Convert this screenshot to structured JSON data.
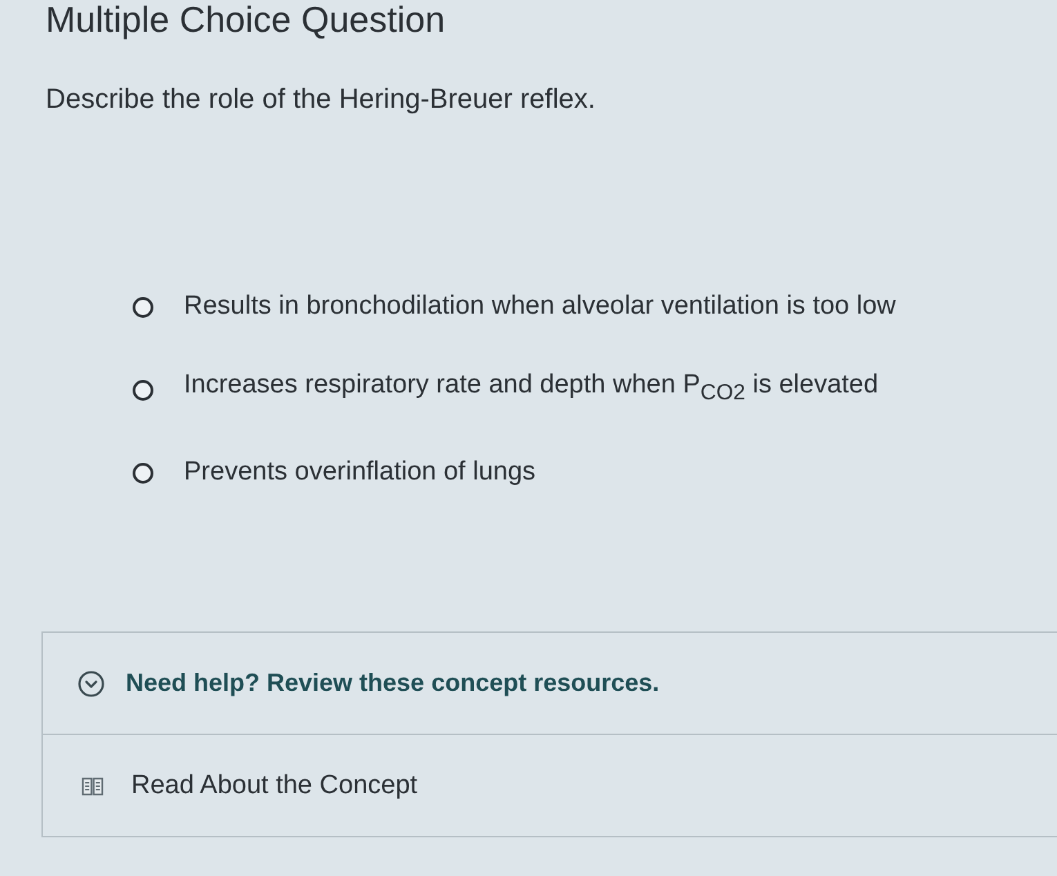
{
  "header": {
    "title": "Multiple Choice Question"
  },
  "question": {
    "prompt": "Describe the role of the Hering-Breuer reflex.",
    "options": [
      {
        "text": "Results in bronchodilation when alveolar ventilation is too low",
        "selected": false
      },
      {
        "text": "Increases respiratory rate and depth when P$_{CO2}$ is elevated",
        "selected": false
      },
      {
        "text": "Prevents overinflation of lungs",
        "selected": false
      }
    ]
  },
  "help": {
    "title": "Need help? Review these concept resources.",
    "resources": [
      {
        "label": "Read About the Concept"
      }
    ]
  }
}
